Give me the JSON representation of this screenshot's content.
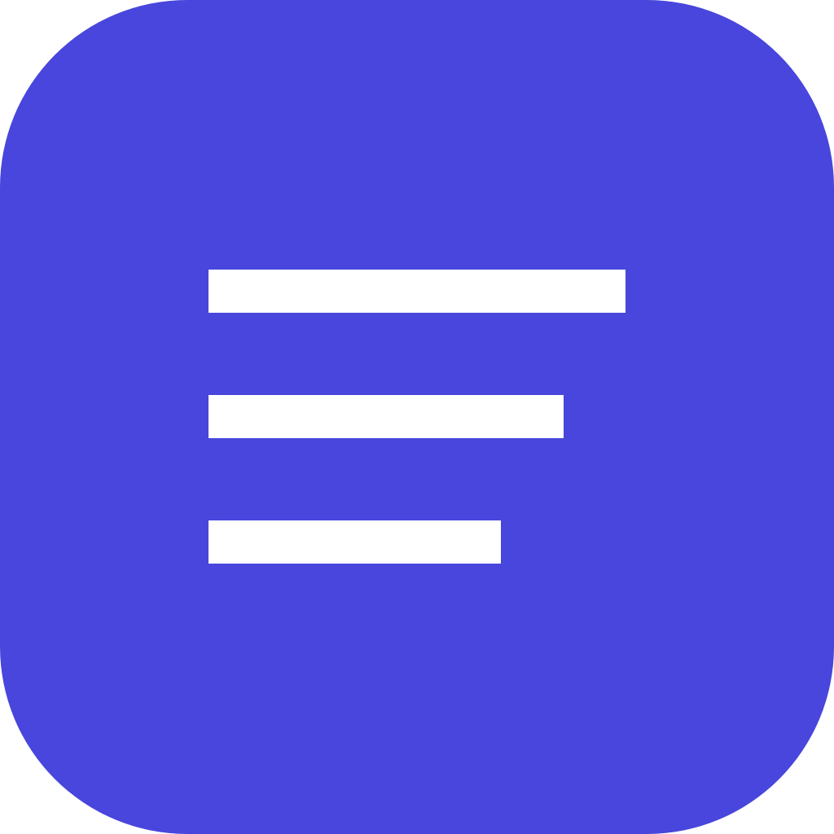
{
  "icon": {
    "name": "menu-lines-icon",
    "background_color": "#4846dc",
    "line_color": "#ffffff",
    "line_count": 3
  }
}
